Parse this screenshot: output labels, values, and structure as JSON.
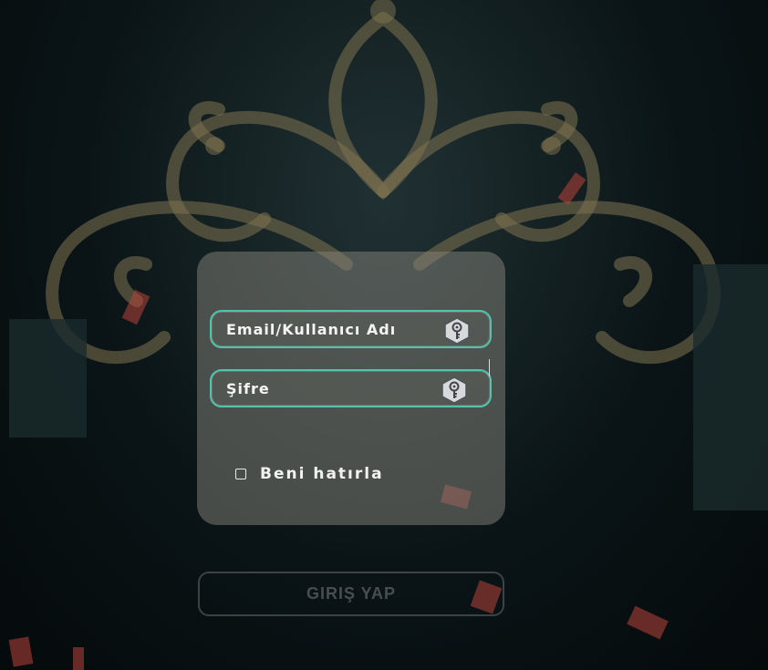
{
  "form": {
    "username_placeholder": "Email/Kullanıcı Adı",
    "password_placeholder": "Şifre",
    "remember_label": "Beni hatırla",
    "login_label": "GIRIŞ YAP",
    "field_icon": "key-hexagon-icon",
    "remember_checked": false
  },
  "colors": {
    "field_border": "#4fc6ac",
    "ornament": "#8a7a52",
    "background": "#0b1314"
  }
}
